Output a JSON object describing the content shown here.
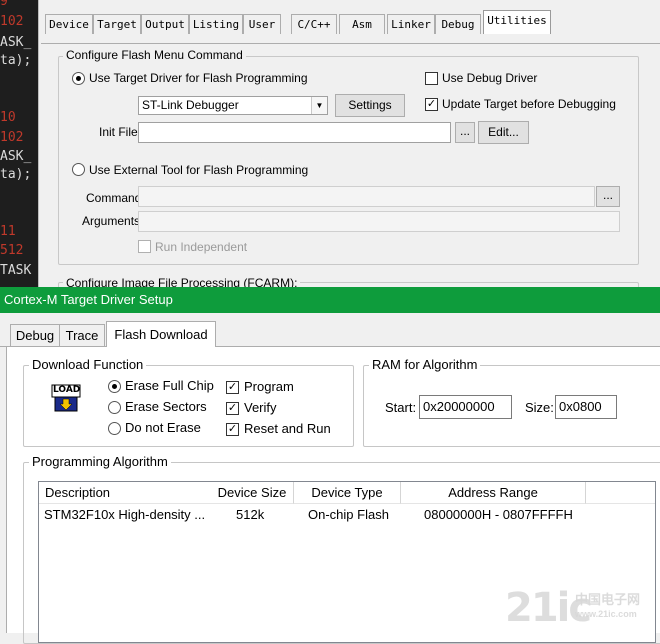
{
  "background_code": {
    "lines": [
      {
        "num": "9",
        "text": ""
      },
      {
        "num": "102",
        "text": ""
      },
      {
        "num": "",
        "text": "ASK_"
      },
      {
        "num": "",
        "text": "ta);"
      },
      {
        "num": "10",
        "text": ""
      },
      {
        "num": "102",
        "text": ""
      },
      {
        "num": "",
        "text": "ASK_"
      },
      {
        "num": "",
        "text": "ta);"
      },
      {
        "num": "11",
        "text": ""
      },
      {
        "num": "512",
        "text": ""
      },
      {
        "num": "",
        "text": "TASK"
      }
    ]
  },
  "options_dialog": {
    "tabs": [
      "Device",
      "Target",
      "Output",
      "Listing",
      "User",
      "C/C++",
      "Asm",
      "Linker",
      "Debug",
      "Utilities"
    ],
    "active_tab": "Utilities",
    "flash_group_title": "Configure Flash Menu Command",
    "use_target_driver_label": "Use Target Driver for Flash Programming",
    "driver_select_value": "ST-Link Debugger",
    "settings_button": "Settings",
    "use_debug_driver_label": "Use Debug Driver",
    "update_target_label": "Update Target before Debugging",
    "init_file_label": "Init File:",
    "browse_button": "...",
    "edit_button": "Edit...",
    "use_external_tool_label": "Use External Tool for Flash Programming",
    "command_label": "Command:",
    "arguments_label": "Arguments:",
    "run_independent_label": "Run Independent",
    "image_group_title": "Configure Image File Processing (FCARM):"
  },
  "cortex_dialog": {
    "title": "Cortex-M Target Driver Setup",
    "tabs": [
      "Debug",
      "Trace",
      "Flash Download"
    ],
    "active_tab": "Flash Download",
    "download_function": {
      "title": "Download Function",
      "load_icon_text": "LOAD",
      "erase_full_chip": "Erase Full Chip",
      "erase_sectors": "Erase Sectors",
      "do_not_erase": "Do not Erase",
      "program": "Program",
      "verify": "Verify",
      "reset_and_run": "Reset and Run"
    },
    "ram_for_algorithm": {
      "title": "RAM for Algorithm",
      "start_label": "Start:",
      "start_value": "0x20000000",
      "size_label": "Size:",
      "size_value": "0x0800"
    },
    "programming_algorithm": {
      "title": "Programming Algorithm",
      "columns": [
        "Description",
        "Device Size",
        "Device Type",
        "Address Range"
      ],
      "rows": [
        [
          "STM32F10x High-density ...",
          "512k",
          "On-chip Flash",
          "08000000H - 0807FFFFH"
        ]
      ]
    }
  },
  "watermark": {
    "text": "21ic",
    "sub1": "中国电子网",
    "sub2": "www.21ic.com"
  }
}
